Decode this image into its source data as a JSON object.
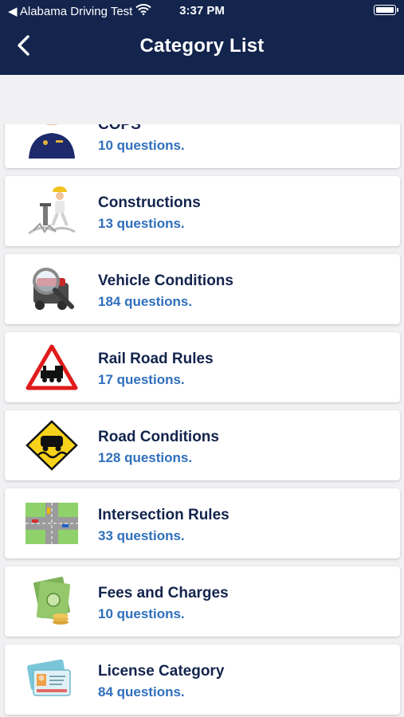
{
  "status": {
    "carrier": "◀ Alabama Driving Test",
    "time": "3:37 PM"
  },
  "header": {
    "title": "Category List"
  },
  "categories": [
    {
      "name": "COPS",
      "count": "10 questions.",
      "icon": "police-officer-icon"
    },
    {
      "name": "Constructions",
      "count": "13 questions.",
      "icon": "construction-worker-icon"
    },
    {
      "name": "Vehicle Conditions",
      "count": "184 questions.",
      "icon": "engine-magnifier-icon"
    },
    {
      "name": "Rail Road Rules",
      "count": "17 questions.",
      "icon": "railroad-crossing-sign-icon"
    },
    {
      "name": "Road Conditions",
      "count": "128 questions.",
      "icon": "slippery-road-sign-icon"
    },
    {
      "name": "Intersection Rules",
      "count": "33 questions.",
      "icon": "intersection-map-icon"
    },
    {
      "name": "Fees and Charges",
      "count": "10 questions.",
      "icon": "money-bills-icon"
    },
    {
      "name": "License Category",
      "count": "84 questions.",
      "icon": "driver-license-cards-icon"
    }
  ],
  "colors": {
    "header_bg": "#13244d",
    "title_text": "#13244d",
    "count_text": "#2f6fbc",
    "page_bg": "#f1f1f3"
  }
}
